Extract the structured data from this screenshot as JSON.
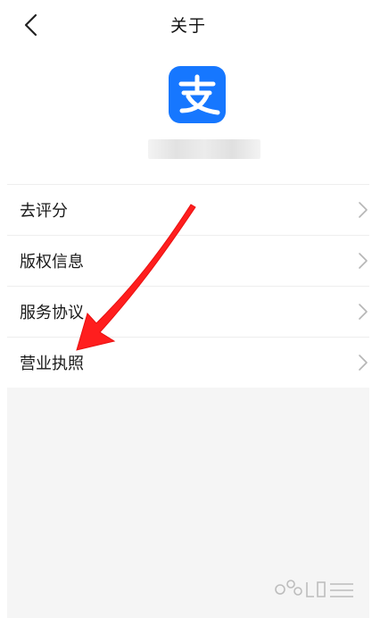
{
  "header": {
    "title": "关于",
    "back_icon": "chevron-left-icon"
  },
  "app": {
    "logo_icon": "alipay-logo",
    "logo_color": "#1677ff"
  },
  "menu": {
    "items": [
      {
        "label": "去评分"
      },
      {
        "label": "版权信息"
      },
      {
        "label": "服务协议"
      },
      {
        "label": "营业执照"
      }
    ],
    "chevron_icon": "chevron-right-icon"
  },
  "annotation": {
    "arrow_color": "#ff1e1e",
    "points_to": "营业执照"
  },
  "watermark": {
    "icon": "baidu-jingyan-logo"
  }
}
